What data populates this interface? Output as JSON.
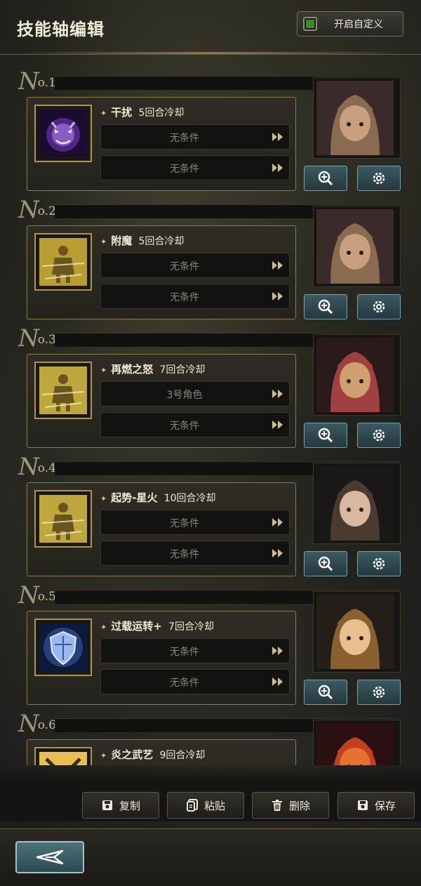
{
  "header": {
    "title": "技能轴编辑",
    "custom_toggle_label": "开启自定义",
    "custom_toggle_color": "#3e8a2a"
  },
  "no_prefix": "N",
  "skills": [
    {
      "number": "o.1",
      "name": "干扰",
      "cooldown": "5回合冷却",
      "icon": "purple-demon-icon",
      "accent": "#7a3fc4",
      "conditions": [
        "无条件",
        "无条件"
      ]
    },
    {
      "number": "o.2",
      "name": "附魔",
      "cooldown": "5回合冷却",
      "icon": "golden-warrior-icon",
      "accent": "#e0c040",
      "conditions": [
        "无条件",
        "无条件"
      ]
    },
    {
      "number": "o.3",
      "name": "再燃之怒",
      "cooldown": "7回合冷却",
      "icon": "golden-warrior-icon",
      "accent": "#e8d050",
      "conditions": [
        "3号角色",
        "无条件"
      ]
    },
    {
      "number": "o.4",
      "name": "起势-星火",
      "cooldown": "10回合冷却",
      "icon": "golden-warrior-icon",
      "accent": "#e8d050",
      "conditions": [
        "无条件",
        "无条件"
      ]
    },
    {
      "number": "o.5",
      "name": "过载运转+",
      "cooldown": "7回合冷却",
      "icon": "blue-shield-icon",
      "accent": "#4a7ad8",
      "conditions": [
        "无条件",
        "无条件"
      ]
    },
    {
      "number": "o.6",
      "name": "炎之武艺",
      "cooldown": "9回合冷却",
      "icon": "crossed-swords-icon",
      "accent": "#e8c050",
      "conditions": []
    }
  ],
  "bottom_actions": {
    "copy": "复制",
    "paste": "粘贴",
    "delete": "删除",
    "save": "保存"
  }
}
